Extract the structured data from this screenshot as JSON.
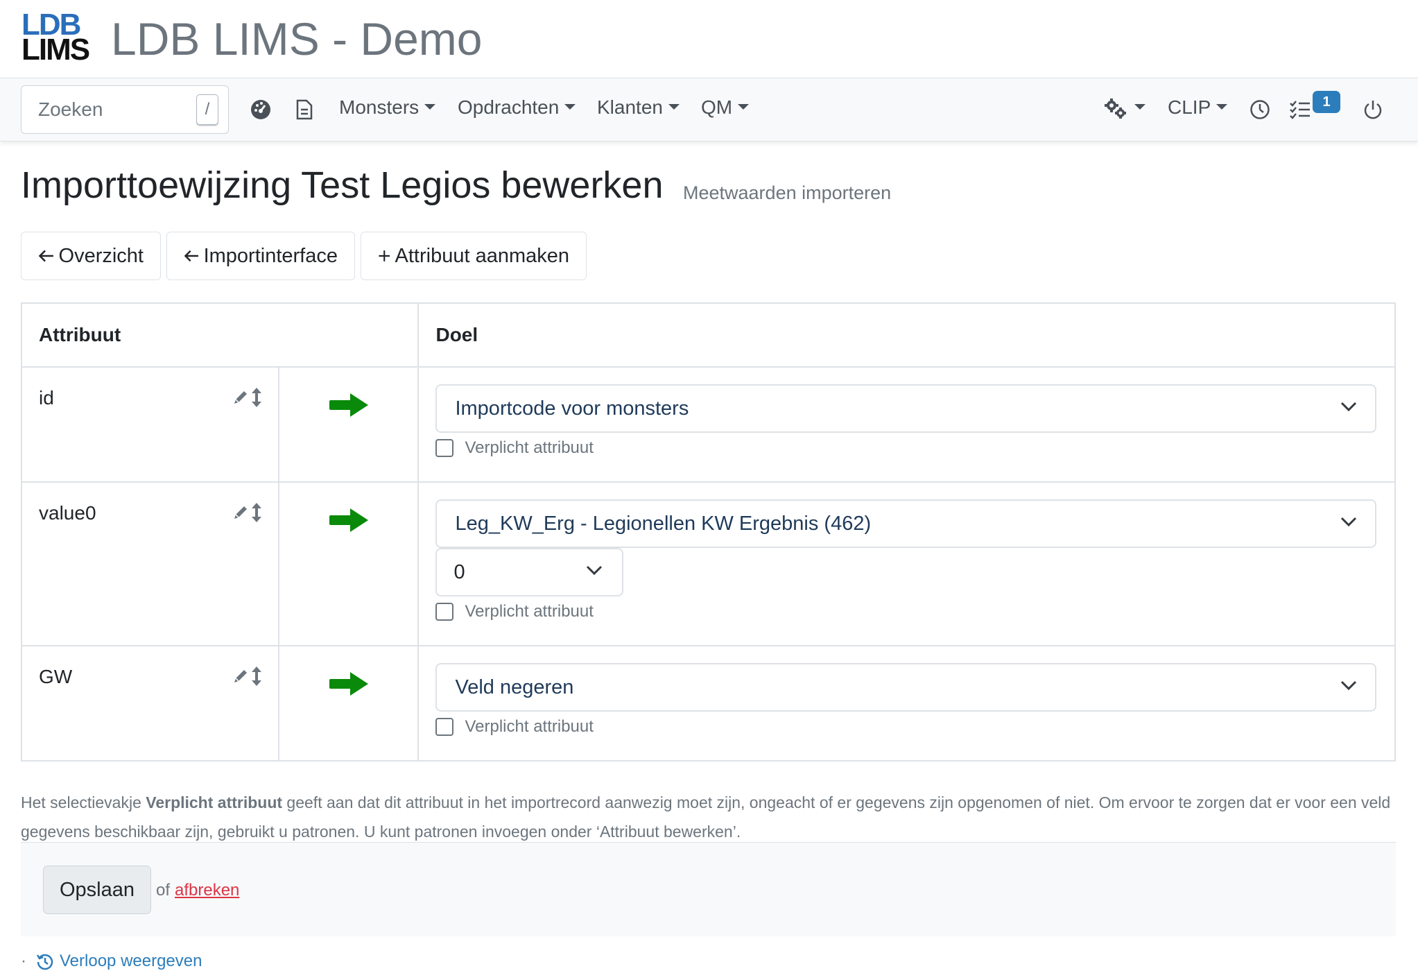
{
  "app": {
    "logo_top": "LDB",
    "logo_bottom": "LIMS",
    "title": "LDB LIMS - Demo"
  },
  "navbar": {
    "search_placeholder": "Zoeken",
    "search_shortcut": "/",
    "menus": [
      "Monsters",
      "Opdrachten",
      "Klanten",
      "QM"
    ],
    "user_menu": "CLIP",
    "tasks_badge": "1"
  },
  "page": {
    "title": "Importtoewijzing Test Legios bewerken",
    "subtitle": "Meetwaarden importeren"
  },
  "actions": {
    "overview": "Overzicht",
    "import_interface": "Importinterface",
    "create_attribute": "Attribuut aanmaken"
  },
  "table": {
    "col_attribute": "Attribuut",
    "col_target": "Doel",
    "rows": [
      {
        "attribute": "id",
        "target": "Importcode voor monsters",
        "required_label": "Verplicht attribuut"
      },
      {
        "attribute": "value0",
        "target": "Leg_KW_Erg - Legionellen KW Ergebnis (462)",
        "sub_select": "0",
        "required_label": "Verplicht attribuut"
      },
      {
        "attribute": "GW",
        "target": "Veld negeren",
        "required_label": "Verplicht attribuut"
      }
    ]
  },
  "help": {
    "prefix": "Het selectievakje ",
    "bold": "Verplicht attribuut",
    "suffix": " geeft aan dat dit attribuut in het importrecord aanwezig moet zijn, ongeacht of er gegevens zijn opgenomen of niet. Om ervoor te zorgen dat er voor een veld gegevens beschikbaar zijn, gebruikt u patronen. U kunt patronen invoegen onder ‘Attribuut bewerken’."
  },
  "footer": {
    "save": "Opslaan",
    "or": "of",
    "cancel": "afbreken",
    "history": "Verloop weergeven"
  },
  "colors": {
    "brand_blue": "#2a6ebb",
    "arrow_green": "#0a8a0a",
    "badge": "#2c7dbb",
    "cancel_red": "#dc3545"
  }
}
